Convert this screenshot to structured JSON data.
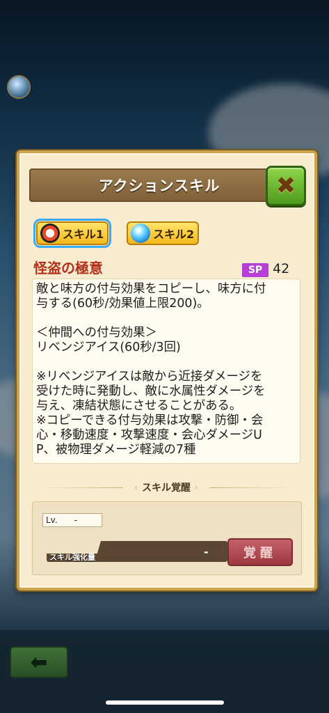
{
  "dialog": {
    "title": "アクションスキル",
    "close_icon": "close-x-icon"
  },
  "tabs": [
    {
      "label": "スキル1",
      "icon": "thief-mask-icon",
      "active": true
    },
    {
      "label": "スキル2",
      "icon": "ice-orb-icon",
      "active": false
    }
  ],
  "skill": {
    "name": "怪盗の極意",
    "sp_label": "SP",
    "sp_value": "42",
    "description": "敵と味方の付与効果をコピーし、味方に付\n与する(60秒/効果値上限200)。\n\n＜仲間への付与効果＞\nリベンジアイス(60秒/3回)\n\n※リベンジアイスは敵から近接ダメージを\n受けた時に発動し、敵に水属性ダメージを\n与え、凍結状態にさせることがある。\n※コピーできる付与効果は攻撃・防御・会\n心・移動速度・攻撃速度・会心ダメージU\nP、被物理ダメージ軽減の7種"
  },
  "awaken": {
    "section_label": "スキル覚醒",
    "lv_label": "Lv.",
    "lv_value": "-",
    "gauge_label": "スキル強化量",
    "gauge_value": "-",
    "button_label": "覚醒"
  },
  "footer": {
    "back_icon": "back-arrow-icon"
  },
  "colors": {
    "accent_title": "#7f6038",
    "close_green": "#4e9a1d",
    "skill_name_red": "#b5301a",
    "sp_purple": "#b63dd6",
    "awaken_button": "#9e3840"
  }
}
